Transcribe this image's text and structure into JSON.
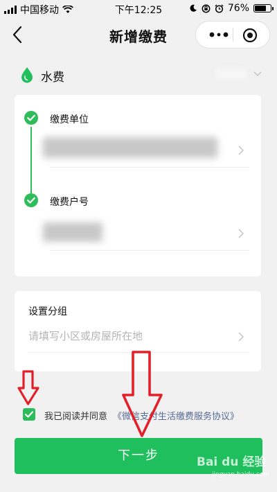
{
  "status_bar": {
    "carrier": "中国移动",
    "time": "下午12:25",
    "battery": "76%",
    "battery_level": 0.76
  },
  "nav": {
    "title": "新增缴费",
    "back_icon": "chevron-left-icon",
    "more_icon": "more-dots-icon",
    "close_icon": "target-circle-icon"
  },
  "category": {
    "label": "水费",
    "icon": "water-drop-icon"
  },
  "steps": [
    {
      "title": "缴费单位",
      "icon": "check-circle-icon"
    },
    {
      "title": "缴费户号",
      "icon": "check-circle-icon"
    }
  ],
  "group": {
    "label": "设置分组",
    "placeholder": "请填写小区或房屋所在地"
  },
  "agreement": {
    "checked": true,
    "text": "我已阅读并同意",
    "link": "《微信支付生活缴费服务协议》"
  },
  "next_button": {
    "label": "下一步"
  },
  "watermark": {
    "text": "Bai du 经验",
    "url": "jingyan.baidu.com"
  },
  "colors": {
    "accent": "#20bf5e",
    "link": "#576b95",
    "annotation": "#e2202a",
    "background": "#f1f1f1"
  }
}
